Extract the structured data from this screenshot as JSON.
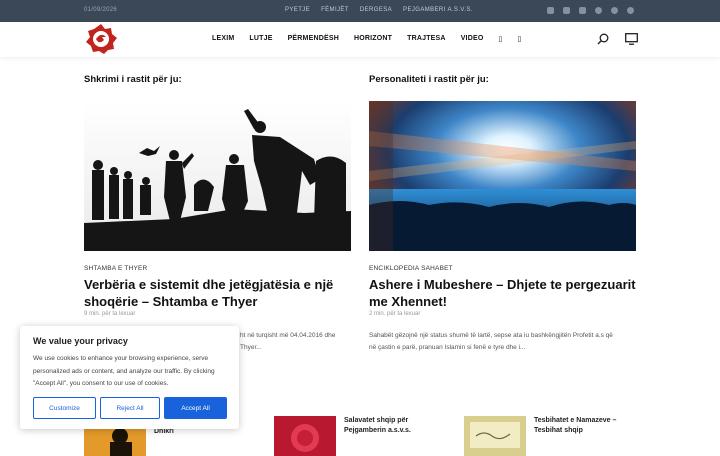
{
  "topbar": {
    "date": "01/09/2026",
    "links": [
      "PYETJE",
      "FËMIJËT",
      "DERGESA",
      "PEJGAMBERI A.S.V.S."
    ],
    "social_icons": [
      "youtube-icon",
      "square-icon",
      "instagram-icon",
      "facebook-icon",
      "twitter-icon",
      "pinterest-icon"
    ]
  },
  "nav": {
    "items": [
      "LEXIM",
      "LUTJE",
      "PËRMENDËSH",
      "HORIZONT",
      "TRAJTESA",
      "VIDEO",
      "▯",
      "▯"
    ]
  },
  "left": {
    "section_title": "Shkrimi i rastit për ju:",
    "category": "SHTAMBA E THYER",
    "title": "Verbëria e sistemit dhe jetëgjatësia e një shoqërie – Shtamba e Thyer",
    "meta": "9 min. për ta lexuar",
    "excerpt_line1": "ht në turqisht më 04.04.2016 dhe",
    "excerpt_line2": "Thyer..."
  },
  "right": {
    "section_title": "Personaliteti i rastit për ju:",
    "category": "ENCIKLOPEDIA SAHABET",
    "title": "Ashere i Mubeshere – Dhjete te pergezuarit me Xhennet!",
    "meta": "2 min. për ta lexuar",
    "excerpt_line1": "Sahabët gëzojnë një status shumë të lartë, sepse ata iu bashkëngjitën Profetit a.s që",
    "excerpt_line2": "në çastin e parë, pranuan Islamin si fenë e tyre dhe i..."
  },
  "bottom": [
    {
      "title_line1": "Dhikri",
      "title_line2": ""
    },
    {
      "title_line1": "Salavatet shqip për",
      "title_line2": "Pejgamberin a.s.v.s."
    },
    {
      "title_line1": "Tesbihatet e Namazeve –",
      "title_line2": "Tesbihat shqip"
    }
  ],
  "cookie": {
    "title": "We value your privacy",
    "body": "We use cookies to enhance your browsing experience, serve personalized ads or content, and analyze our traffic. By clicking \"Accept All\", you consent to our use of cookies.",
    "customize": "Customize",
    "reject": "Reject All",
    "accept": "Accept All"
  },
  "colors": {
    "topbar": "#3a4858",
    "brand_red": "#c0241c",
    "button_blue": "#1863dc"
  }
}
